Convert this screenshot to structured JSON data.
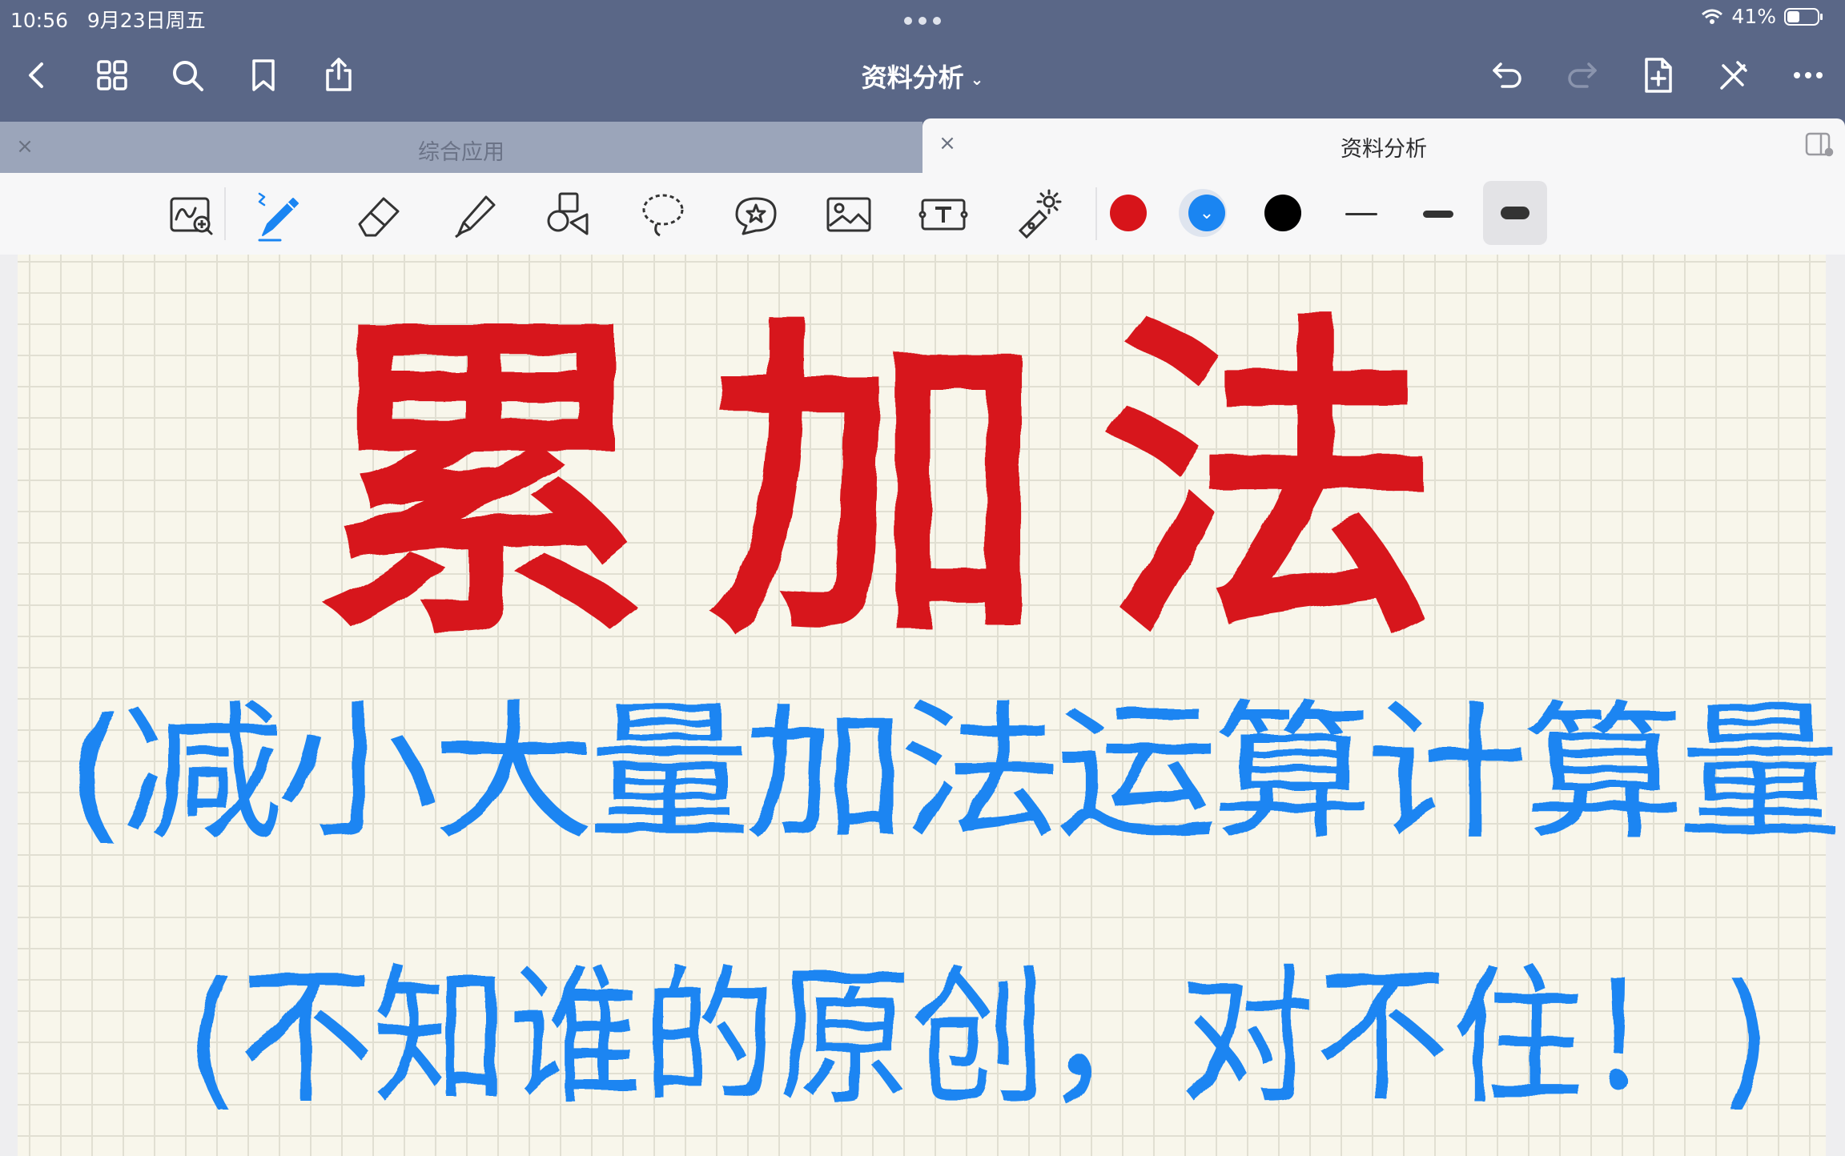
{
  "status_bar": {
    "time": "10:56",
    "date": "9月23日周五",
    "battery": "41%"
  },
  "nav_bar": {
    "title": "资料分析",
    "icons": [
      "back-icon",
      "grid-icon",
      "search-icon",
      "bookmark-icon",
      "share-icon",
      "undo-icon",
      "redo-icon",
      "add-page-icon",
      "close-pen-icon",
      "more-icon"
    ]
  },
  "tabs": [
    {
      "label": "综合应用",
      "active": false
    },
    {
      "label": "资料分析",
      "active": true
    }
  ],
  "toolbar": {
    "tools": [
      "zoom-window-icon",
      "pen-icon",
      "eraser-icon",
      "highlighter-icon",
      "shapes-icon",
      "lasso-icon",
      "sticker-icon",
      "image-icon",
      "text-icon",
      "laser-pointer-icon"
    ],
    "colors": [
      "#d7141a",
      "#1a85f2",
      "#000000"
    ],
    "selected_color": "#1a85f2",
    "stroke_widths": [
      "thin",
      "medium",
      "thick"
    ],
    "selected_width": "thick"
  },
  "handwriting": {
    "title": "累加法",
    "line1": "(减小大量加法运算计算量",
    "line2": "(不知谁的原创，对不住！)",
    "title_color": "#d7141a",
    "body_color": "#1a85f2"
  }
}
